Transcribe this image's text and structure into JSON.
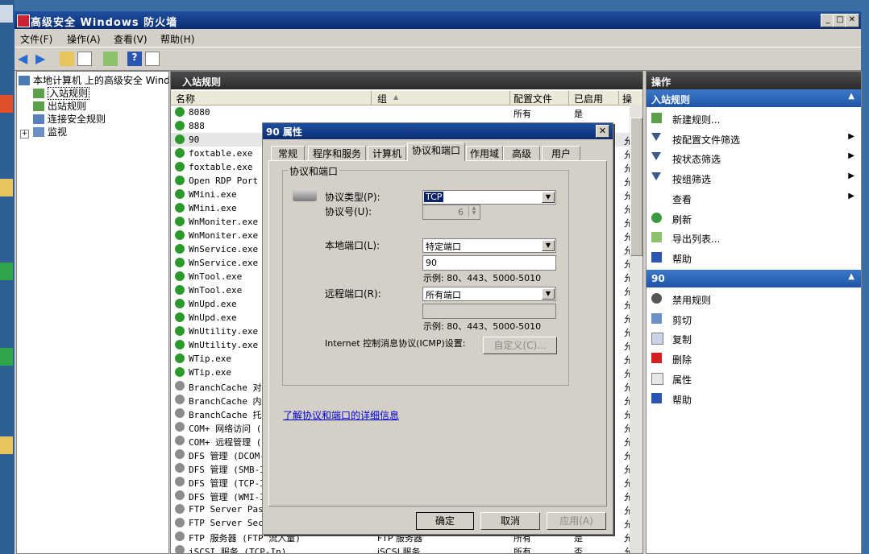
{
  "window": {
    "title": "高级安全 Windows 防火墙"
  },
  "menu": [
    "文件(F)",
    "操作(A)",
    "查看(V)",
    "帮助(H)"
  ],
  "tree": {
    "root": "本地计算机 上的高级安全 Wind",
    "items": [
      "入站规则",
      "出站规则",
      "连接安全规则",
      "监视"
    ]
  },
  "center": {
    "header": "入站规则",
    "columns": [
      "名称",
      "组",
      "配置文件",
      "已启用",
      "操"
    ],
    "rows": [
      {
        "name": "8080",
        "group": "",
        "profile": "所有",
        "enabled": "是",
        "op": ""
      },
      {
        "name": "888",
        "group": "",
        "profile": "",
        "enabled": "",
        "op": ""
      },
      {
        "name": "90",
        "group": "",
        "profile": "",
        "enabled": "",
        "op": "允"
      },
      {
        "name": "foxtable.exe",
        "group": "",
        "profile": "",
        "enabled": "",
        "op": "允"
      },
      {
        "name": "foxtable.exe",
        "group": "",
        "profile": "",
        "enabled": "",
        "op": "允"
      },
      {
        "name": "Open RDP Port 3",
        "group": "",
        "profile": "",
        "enabled": "",
        "op": "允"
      },
      {
        "name": "WMini.exe",
        "group": "",
        "profile": "",
        "enabled": "",
        "op": "允"
      },
      {
        "name": "WMini.exe",
        "group": "",
        "profile": "",
        "enabled": "",
        "op": "允"
      },
      {
        "name": "WnMoniter.exe",
        "group": "",
        "profile": "",
        "enabled": "",
        "op": "允"
      },
      {
        "name": "WnMoniter.exe",
        "group": "",
        "profile": "",
        "enabled": "",
        "op": "允"
      },
      {
        "name": "WnService.exe",
        "group": "",
        "profile": "",
        "enabled": "",
        "op": "允"
      },
      {
        "name": "WnService.exe",
        "group": "",
        "profile": "",
        "enabled": "",
        "op": "允"
      },
      {
        "name": "WnTool.exe",
        "group": "",
        "profile": "",
        "enabled": "",
        "op": "允"
      },
      {
        "name": "WnTool.exe",
        "group": "",
        "profile": "",
        "enabled": "",
        "op": "允"
      },
      {
        "name": "WnUpd.exe",
        "group": "",
        "profile": "",
        "enabled": "",
        "op": "允"
      },
      {
        "name": "WnUpd.exe",
        "group": "",
        "profile": "",
        "enabled": "",
        "op": "允"
      },
      {
        "name": "WnUtility.exe",
        "group": "",
        "profile": "",
        "enabled": "",
        "op": "允"
      },
      {
        "name": "WnUtility.exe",
        "group": "",
        "profile": "",
        "enabled": "",
        "op": "允"
      },
      {
        "name": "WTip.exe",
        "group": "",
        "profile": "",
        "enabled": "",
        "op": "允"
      },
      {
        "name": "WTip.exe",
        "group": "",
        "profile": "",
        "enabled": "",
        "op": "允"
      },
      {
        "name": "BranchCache 对等",
        "group": "",
        "profile": "",
        "enabled": "",
        "op": "允"
      },
      {
        "name": "BranchCache 内容",
        "group": "",
        "profile": "",
        "enabled": "",
        "op": "允"
      },
      {
        "name": "BranchCache 托管",
        "group": "",
        "profile": "",
        "enabled": "",
        "op": "允"
      },
      {
        "name": "COM+ 网络访问 (D",
        "group": "",
        "profile": "",
        "enabled": "",
        "op": "允"
      },
      {
        "name": "COM+ 远程管理 (D",
        "group": "",
        "profile": "",
        "enabled": "",
        "op": "允"
      },
      {
        "name": "DFS 管理 (DCOM-I",
        "group": "",
        "profile": "",
        "enabled": "",
        "op": "允"
      },
      {
        "name": "DFS 管理 (SMB-In",
        "group": "",
        "profile": "",
        "enabled": "",
        "op": "允"
      },
      {
        "name": "DFS 管理 (TCP-In",
        "group": "",
        "profile": "",
        "enabled": "",
        "op": "允"
      },
      {
        "name": "DFS 管理 (WMI-In",
        "group": "",
        "profile": "",
        "enabled": "",
        "op": "允"
      },
      {
        "name": "FTP Server Pass",
        "group": "",
        "profile": "",
        "enabled": "",
        "op": "允"
      },
      {
        "name": "FTP Server Secu",
        "group": "",
        "profile": "",
        "enabled": "",
        "op": "允"
      },
      {
        "name": "FTP 服务器 (FTP 流入量)",
        "group": "FTP 服务器",
        "profile": "所有",
        "enabled": "是",
        "op": "允"
      },
      {
        "name": "iSCSI 服务 (TCP-In)",
        "group": "iSCSI 服务",
        "profile": "所有",
        "enabled": "否",
        "op": "允"
      }
    ]
  },
  "actions": {
    "header": "操作",
    "section1": "入站规则",
    "items1": [
      {
        "label": "新建规则...",
        "icon": "new-rule-icon",
        "arrow": false
      },
      {
        "label": "按配置文件筛选",
        "icon": "filter-icon",
        "arrow": true
      },
      {
        "label": "按状态筛选",
        "icon": "filter-icon",
        "arrow": true
      },
      {
        "label": "按组筛选",
        "icon": "filter-icon",
        "arrow": true
      },
      {
        "label": "查看",
        "icon": "",
        "arrow": true
      },
      {
        "label": "刷新",
        "icon": "refresh-icon",
        "arrow": false
      },
      {
        "label": "导出列表...",
        "icon": "export-icon",
        "arrow": false
      },
      {
        "label": "帮助",
        "icon": "help-icon",
        "arrow": false
      }
    ],
    "section2": "90",
    "items2": [
      {
        "label": "禁用规则",
        "icon": "disable-icon"
      },
      {
        "label": "剪切",
        "icon": "cut-icon"
      },
      {
        "label": "复制",
        "icon": "copy-icon"
      },
      {
        "label": "删除",
        "icon": "delete-icon"
      },
      {
        "label": "属性",
        "icon": "properties-icon"
      },
      {
        "label": "帮助",
        "icon": "help-icon"
      }
    ]
  },
  "dialog": {
    "title": "90 属性",
    "tabs": [
      "常规",
      "程序和服务",
      "计算机",
      "协议和端口",
      "作用域",
      "高级",
      "用户"
    ],
    "active_tab": "协议和端口",
    "group_label": "协议和端口",
    "protocol_type_label": "协议类型(P):",
    "protocol_type_value": "TCP",
    "protocol_number_label": "协议号(U):",
    "protocol_number_value": "6",
    "local_port_label": "本地端口(L):",
    "local_port_mode": "特定端口",
    "local_port_value": "90",
    "local_example": "示例: 80、443、5000-5010",
    "remote_port_label": "远程端口(R):",
    "remote_port_mode": "所有端口",
    "remote_port_value": "",
    "remote_example": "示例: 80、443、5000-5010",
    "icmp_label": "Internet 控制消息协议(ICMP)设置:",
    "customize_button": "自定义(C)...",
    "learn_more_link": "了解协议和端口的详细信息",
    "ok_button": "确定",
    "cancel_button": "取消",
    "apply_button": "应用(A)"
  }
}
